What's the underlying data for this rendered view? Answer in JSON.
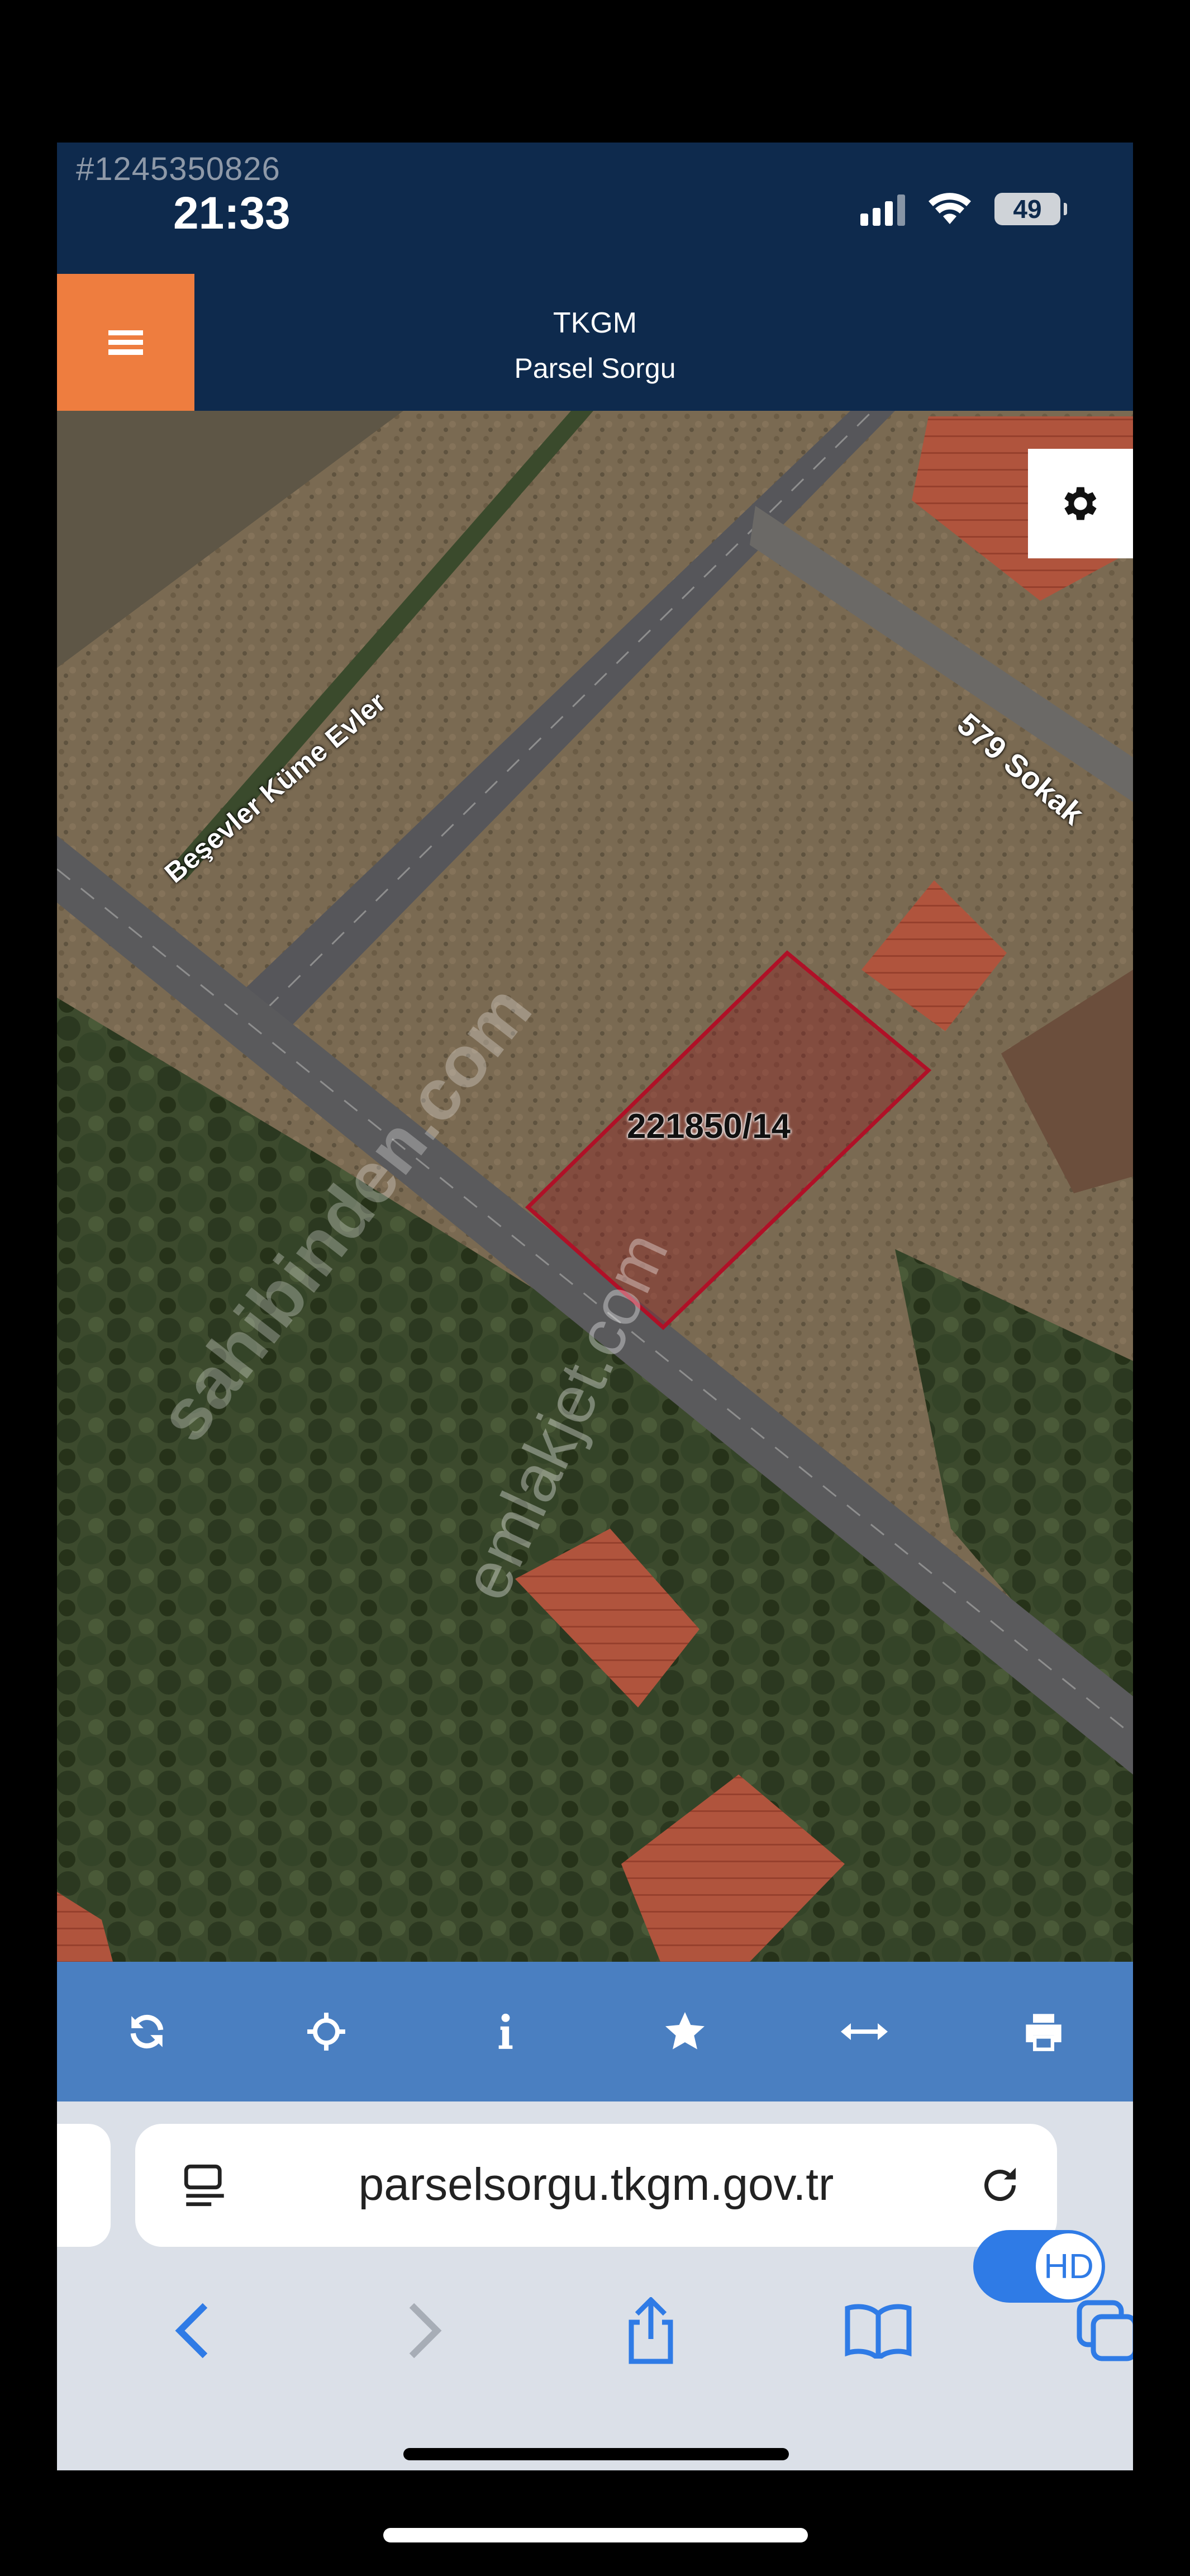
{
  "status_bar": {
    "listing_id": "#1245350826",
    "time": "21:33",
    "battery": "49"
  },
  "app_bar": {
    "title": "TKGM",
    "subtitle": "Parsel Sorgu",
    "menu_icon": "hamburger-menu-icon"
  },
  "map": {
    "parcel_label": "221850/14",
    "street_labels": [
      "Beşevler Küme Evler",
      "579 Sokak"
    ],
    "settings_icon": "gear-icon",
    "parcel_color": "#c8102e"
  },
  "toolbar": {
    "buttons": [
      {
        "icon": "refresh-icon"
      },
      {
        "icon": "locate-crosshair-icon"
      },
      {
        "icon": "info-icon"
      },
      {
        "icon": "star-icon"
      },
      {
        "icon": "measure-arrows-icon"
      },
      {
        "icon": "print-icon"
      }
    ]
  },
  "browser": {
    "url": "parselsorgu.tkgm.gov.tr",
    "nav_icons": [
      "back-icon",
      "forward-icon",
      "share-icon",
      "bookmarks-icon",
      "tabs-icon"
    ]
  },
  "overlay": {
    "hd_label": "HD",
    "watermarks": [
      "sahibinden.com",
      "emlakjet.com"
    ]
  },
  "colors": {
    "header_bg": "#0e2a4d",
    "menu_button": "#ee7d3f",
    "toolbar_bg": "#4a7fc1",
    "browser_bg": "#dbe0e8"
  }
}
